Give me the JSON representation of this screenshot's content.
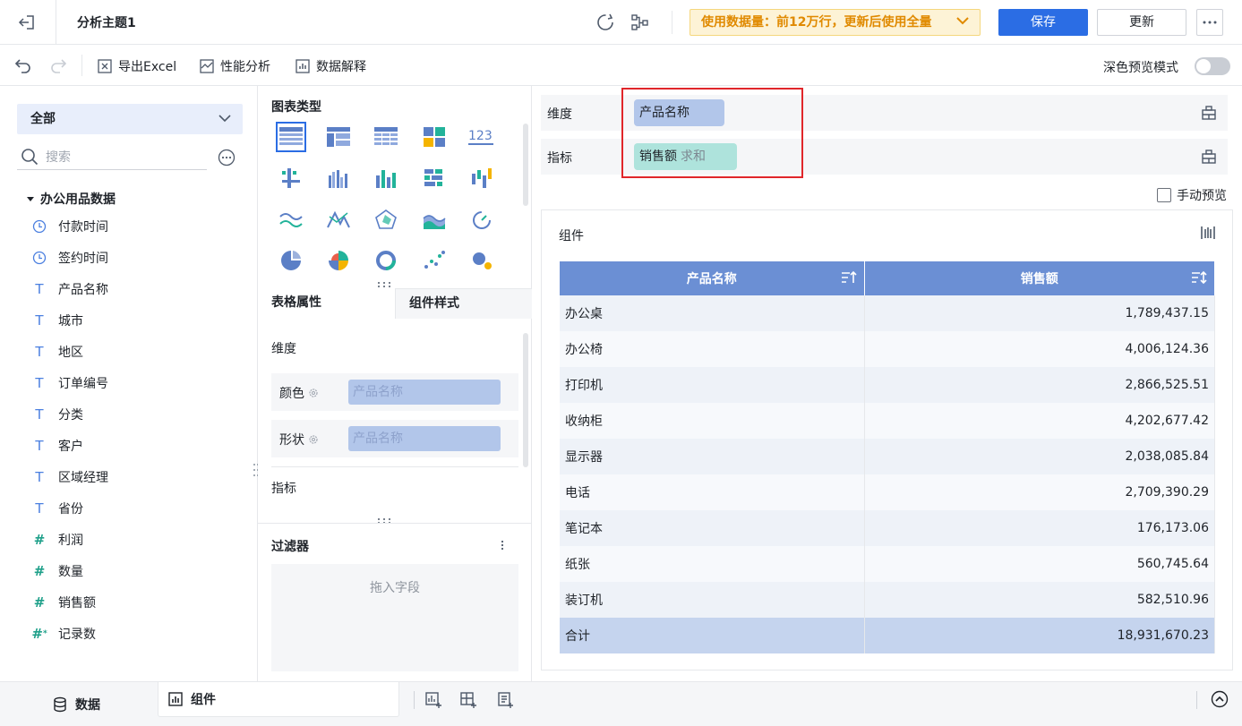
{
  "header": {
    "title": "分析主题1",
    "notice": "使用数据量：前12万行，更新后使用全量",
    "save_label": "保存",
    "update_label": "更新"
  },
  "toolbar": {
    "export_label": "导出Excel",
    "perf_label": "性能分析",
    "explain_label": "数据解释",
    "dark_mode_label": "深色预览模式"
  },
  "left": {
    "dataset_select": "全部",
    "search_placeholder": "搜索",
    "tree_root": "办公用品数据",
    "fields": [
      {
        "name": "付款时间",
        "type": "date"
      },
      {
        "name": "签约时间",
        "type": "date"
      },
      {
        "name": "产品名称",
        "type": "text"
      },
      {
        "name": "城市",
        "type": "text"
      },
      {
        "name": "地区",
        "type": "text"
      },
      {
        "name": "订单编号",
        "type": "text"
      },
      {
        "name": "分类",
        "type": "text"
      },
      {
        "name": "客户",
        "type": "text"
      },
      {
        "name": "区域经理",
        "type": "text"
      },
      {
        "name": "省份",
        "type": "text"
      },
      {
        "name": "利润",
        "type": "number"
      },
      {
        "name": "数量",
        "type": "number"
      },
      {
        "name": "销售额",
        "type": "number"
      },
      {
        "name": "记录数",
        "type": "number-calc"
      }
    ]
  },
  "middle": {
    "chart_types_title": "图表类型",
    "tab_table_props": "表格属性",
    "tab_component_style": "组件样式",
    "dimension_label": "维度",
    "color_label": "颜色",
    "color_value": "产品名称",
    "shape_label": "形状",
    "shape_value": "产品名称",
    "measure_label": "指标",
    "filter_title": "过滤器",
    "filter_placeholder": "拖入字段"
  },
  "right": {
    "dimension_label": "维度",
    "dimension_chip": "产品名称",
    "measure_label": "指标",
    "measure_chip": "销售额",
    "measure_agg": "求和",
    "manual_preview": "手动预览",
    "component_title": "组件",
    "table": {
      "headers": [
        "产品名称",
        "销售额"
      ],
      "rows": [
        [
          "办公桌",
          "1,789,437.15"
        ],
        [
          "办公椅",
          "4,006,124.36"
        ],
        [
          "打印机",
          "2,866,525.51"
        ],
        [
          "收纳柜",
          "4,202,677.42"
        ],
        [
          "显示器",
          "2,038,085.84"
        ],
        [
          "电话",
          "2,709,390.29"
        ],
        [
          "笔记本",
          "176,173.06"
        ],
        [
          "纸张",
          "560,745.64"
        ],
        [
          "装订机",
          "582,510.96"
        ]
      ],
      "total_label": "合计",
      "total_value": "18,931,670.23"
    }
  },
  "bottom": {
    "data_tab": "数据",
    "component_tab": "组件"
  },
  "colors": {
    "primary": "#2b6de4",
    "notice_text": "#e08a00",
    "header_blue": "#6b8fd4",
    "dim_chip": "#b2c6ea",
    "measure_chip": "#aee3dc",
    "highlight_red": "#e0262a"
  }
}
